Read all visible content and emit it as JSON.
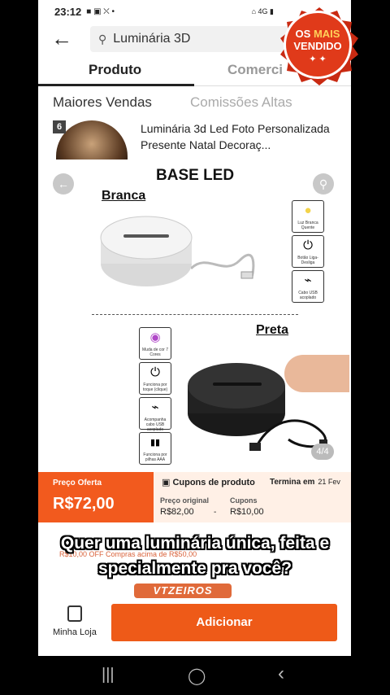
{
  "status": {
    "time": "23:12",
    "icons": "■ ▣ ⛌ •",
    "right": "⌂ 4G ▮"
  },
  "search": {
    "back": "←",
    "query": "Luminária 3D"
  },
  "tabs": {
    "active": "Produto",
    "inactive": "Comerci"
  },
  "filters": {
    "left": "Maiores Vendas",
    "right": "Comissões Altas"
  },
  "product": {
    "rank": "6",
    "title": "Luminária 3d Led Foto Personalizada Presente Natal Decoraç..."
  },
  "image": {
    "title": "BASE LED",
    "label_white": "Branca",
    "label_black": "Preta",
    "page_indicator": "4/4",
    "features_right": [
      {
        "glyph": "●",
        "text": "Luz Branca Quente"
      },
      {
        "glyph": "⏻",
        "text": "Botão Liga-Desliga"
      },
      {
        "glyph": "⌁",
        "text": "Cabo USB acoplado"
      }
    ],
    "features_left": [
      {
        "glyph": "◉",
        "text": "Muda de cor 7 Cores"
      },
      {
        "glyph": "⏻",
        "text": "Funciona por toque (clique)"
      },
      {
        "glyph": "⌁",
        "text": "Acompanha cabo USB acoplado"
      },
      {
        "glyph": "▮▮",
        "text": "Funciona por pilhas AAA"
      }
    ]
  },
  "price": {
    "offer_label": "Preço Oferta",
    "offer_value": "R$72,00",
    "coupon_title": "Cupons de produto",
    "term_label": "Termina em",
    "term_date": "21 Fev",
    "orig_label": "Preço original",
    "orig_value": "R$82,00",
    "dash": "-",
    "coupon_label": "Cupons",
    "coupon_value": "R$10,00",
    "off_text": "R$10,00 OFF Compras acima de R$50,00"
  },
  "subtitle": {
    "line1": "Quer uma luminária única, feita e",
    "line2": "specialmente pra você?"
  },
  "watermark": "VTZEIROS",
  "bottom": {
    "store_label": "Minha Loja",
    "add_label": "Adicionar"
  },
  "badge": {
    "os": "OS",
    "mais": "MAIS",
    "vendido": "VENDIDO",
    "stars": "✦ ✦"
  },
  "androidnav": {
    "recent": "|||",
    "home": "◯",
    "back": "‹"
  },
  "colors": {
    "accent": "#ee5a18",
    "offer": "#f25a1e",
    "badge": "#e03a1a"
  }
}
